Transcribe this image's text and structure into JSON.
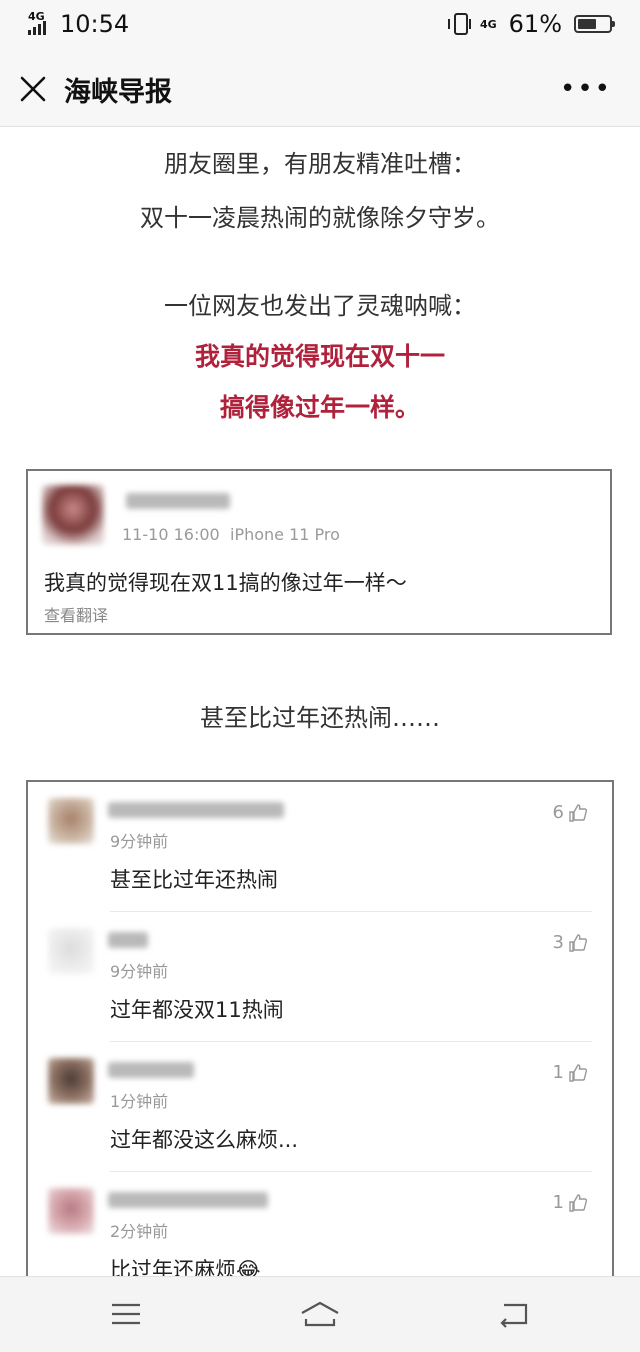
{
  "status": {
    "time": "10:54",
    "network_left": "4G",
    "network_right": "4G",
    "battery": "61%",
    "battery_level": 0.61
  },
  "nav": {
    "title": "海峡导报"
  },
  "article": {
    "p1": "朋友圈里，有朋友精准吐槽：",
    "p2": "双十一凌晨热闹的就像除夕守岁。",
    "p3": "一位网友也发出了灵魂呐喊：",
    "p4": "我真的觉得现在双十一",
    "p5": "搞得像过年一样。",
    "p6": "甚至比过年还热闹……"
  },
  "post": {
    "date": "11-10 16:00",
    "device": "iPhone 11 Pro",
    "text": "我真的觉得现在双11搞的像过年一样～",
    "translate": "查看翻译"
  },
  "comments": [
    {
      "time": "9分钟前",
      "text": "甚至比过年还热闹",
      "likes": "6"
    },
    {
      "time": "9分钟前",
      "text": "过年都没双11热闹",
      "likes": "3"
    },
    {
      "time": "1分钟前",
      "text": "过年都没这么麻烦...",
      "likes": "1"
    },
    {
      "time": "2分钟前",
      "text": "比过年还麻烦😂",
      "likes": "1"
    }
  ],
  "colors": {
    "highlight": "#b0213b"
  },
  "icons": [
    "close-icon",
    "more-icon",
    "thumb-up-icon",
    "menu-icon",
    "home-icon",
    "back-icon"
  ]
}
